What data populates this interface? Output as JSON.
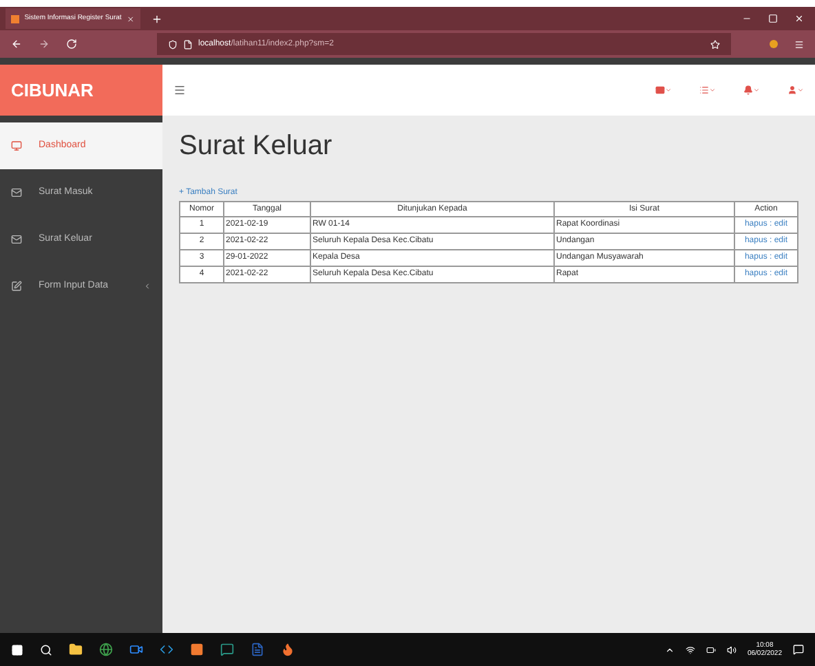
{
  "browser": {
    "tab_title": "Sistem Informasi Register Surat",
    "url_host": "localhost",
    "url_path": "/latihan11/index2.php?sm=2"
  },
  "brand": "CIBUNAR",
  "sidebar": {
    "items": [
      {
        "label": "Dashboard",
        "selected": true,
        "kind": "monitor"
      },
      {
        "label": "Surat Masuk",
        "selected": false,
        "kind": "mail"
      },
      {
        "label": "Surat Keluar",
        "selected": false,
        "kind": "mail"
      },
      {
        "label": "Form Input Data",
        "selected": false,
        "kind": "form"
      }
    ]
  },
  "page_title": "Surat Keluar",
  "add_link": "+ Tambah Surat",
  "table": {
    "action_separator": ":",
    "columns": [
      "Nomor",
      "Tanggal",
      "Ditunjukan Kepada",
      "Isi Surat",
      "Action"
    ],
    "rows": [
      {
        "cells": [
          "1",
          "2021-02-19",
          "RW 01-14",
          "Rapat Koordinasi"
        ],
        "actions": [
          "hapus",
          "edit"
        ]
      },
      {
        "cells": [
          "2",
          "2021-02-22",
          "Seluruh Kepala Desa Kec.Cibatu",
          "Undangan"
        ],
        "actions": [
          "hapus",
          "edit"
        ]
      },
      {
        "cells": [
          "3",
          "29-01-2022",
          "Kepala Desa",
          "Undangan Musyawarah"
        ],
        "actions": [
          "hapus",
          "edit"
        ]
      },
      {
        "cells": [
          "4",
          "2021-02-22",
          "Seluruh Kepala Desa Kec.Cibatu",
          "Rapat"
        ],
        "actions": [
          "hapus",
          "edit"
        ]
      }
    ]
  },
  "taskbar": {
    "time": "10:08",
    "date": "06/02/2022"
  }
}
